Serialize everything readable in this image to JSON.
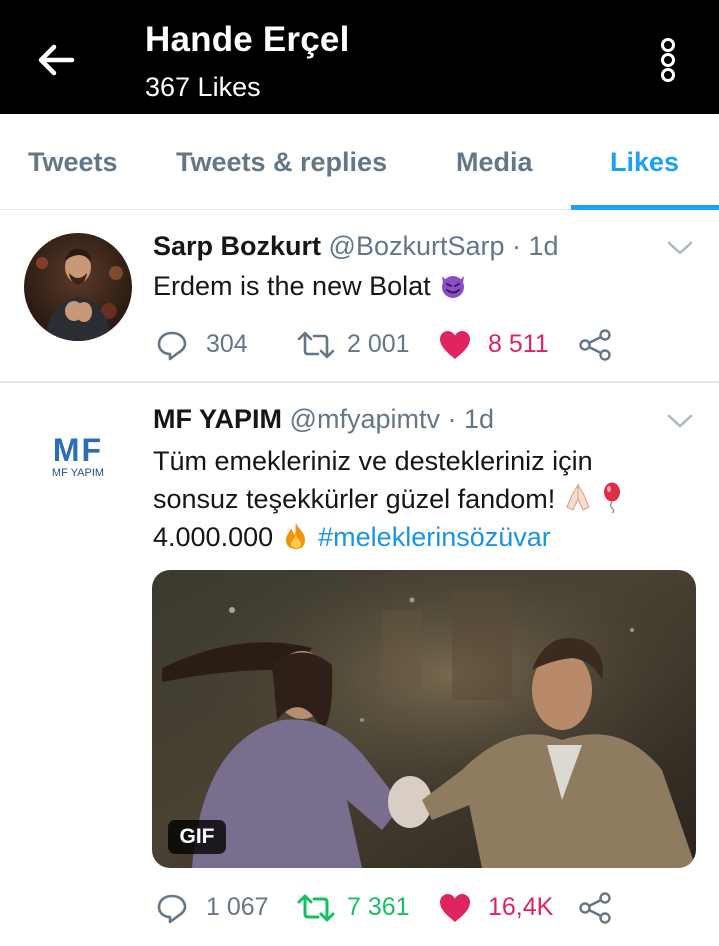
{
  "header": {
    "title": "Hande Erçel",
    "subtitle": "367 Likes",
    "back_icon": "arrow-left-icon",
    "more_icon": "more-vertical-icon"
  },
  "tabs": [
    {
      "label": "Tweets"
    },
    {
      "label": "Tweets & replies"
    },
    {
      "label": "Media"
    },
    {
      "label": "Likes",
      "active": true
    }
  ],
  "tweets": [
    {
      "name": "Sarp Bozkurt",
      "handle": "@BozkurtSarp",
      "time": "· 1d",
      "text": "Erdem is the new Bolat",
      "text_emoji": "smiling-devil-emoji",
      "replies": "304",
      "retweets": "2 001",
      "likes": "8 511",
      "liked": true,
      "retweeted": false
    },
    {
      "name": "MF YAPIM",
      "handle": "@mfyapimtv",
      "time": "· 1d",
      "avatar_label": "MF YAPIM",
      "avatar_logo_text": "MF",
      "text_lines": [
        "Tüm emekleriniz ve destekleriniz için",
        "sonsuz teşekkürler güzel fandom!"
      ],
      "line3_text": "4.000.000",
      "hashtag": "#meleklerinsözüvar",
      "emojis": [
        "folded-hands-emoji",
        "balloon-emoji",
        "fire-emoji"
      ],
      "media_badge": "GIF",
      "replies": "1 067",
      "retweets": "7 361",
      "likes": "16,4K",
      "liked": true,
      "retweeted": true
    }
  ],
  "colors": {
    "accent": "#1da1f2",
    "hashtag": "#1b95e0",
    "like": "#e0245e",
    "retweet": "#17bf63",
    "muted": "#657786"
  }
}
